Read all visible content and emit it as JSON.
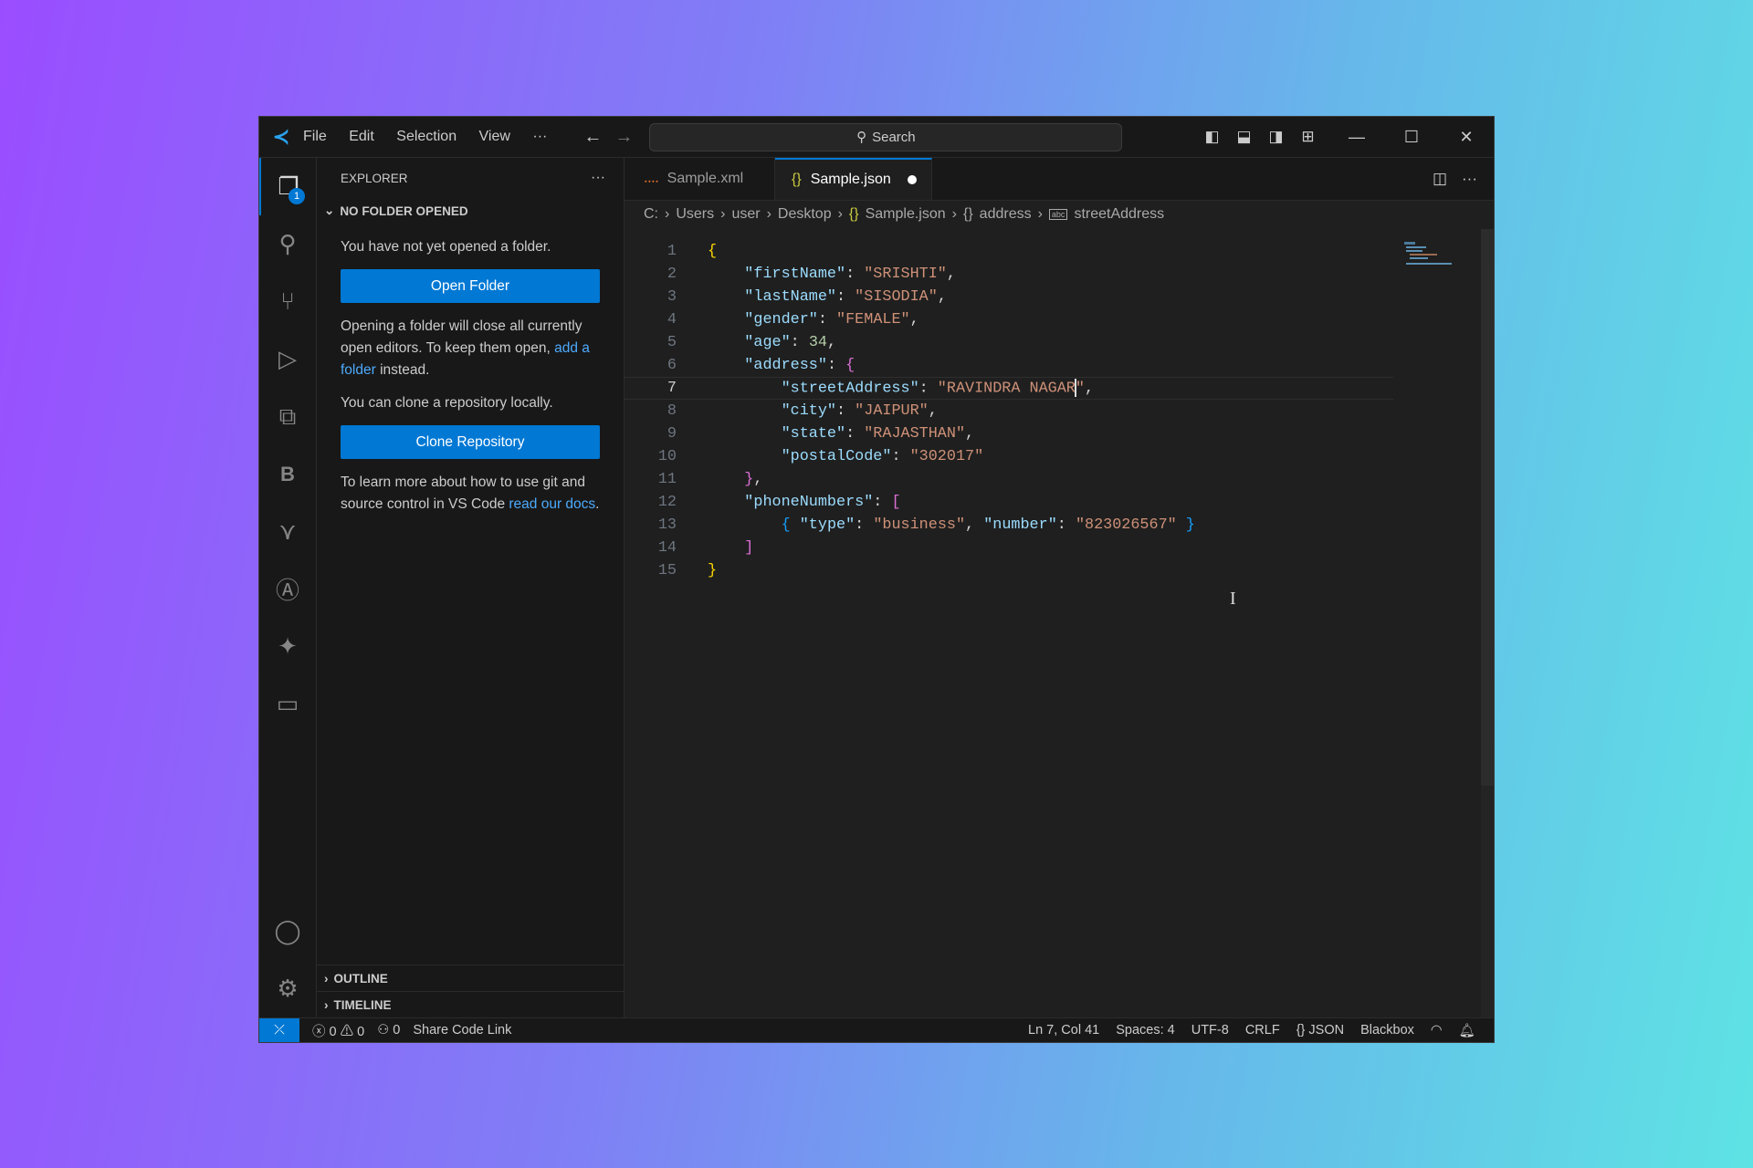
{
  "menu": {
    "items": [
      "File",
      "Edit",
      "Selection",
      "View",
      "···"
    ],
    "search": "Search"
  },
  "activity": {
    "explorer_badge": "1"
  },
  "sidebar": {
    "title": "EXPLORER",
    "more": "···",
    "section": "NO FOLDER OPENED",
    "msg1": "You have not yet opened a folder.",
    "open_folder": "Open Folder",
    "msg2_a": "Opening a folder will close all currently open editors. To keep them open, ",
    "msg2_link": "add a folder",
    "msg2_b": " instead.",
    "msg3": "You can clone a repository locally.",
    "clone": "Clone Repository",
    "msg4_a": "To learn more about how to use git and source control in VS Code ",
    "msg4_link": "read our docs",
    "msg4_b": ".",
    "outline": "OUTLINE",
    "timeline": "TIMELINE"
  },
  "tabs": [
    {
      "label": "Sample.xml"
    },
    {
      "label": "Sample.json",
      "modified": true
    }
  ],
  "breadcrumb": [
    "C:",
    "Users",
    "user",
    "Desktop",
    "Sample.json",
    "address",
    "streetAddress"
  ],
  "code": {
    "current_line": 7,
    "lines": [
      [
        [
          "{",
          "y"
        ]
      ],
      [
        [
          "    ",
          ""
        ],
        [
          "\"firstName\"",
          "k"
        ],
        [
          ": ",
          "p"
        ],
        [
          "\"SRISHTI\"",
          "s"
        ],
        [
          ",",
          "p"
        ]
      ],
      [
        [
          "    ",
          ""
        ],
        [
          "\"lastName\"",
          "k"
        ],
        [
          ": ",
          "p"
        ],
        [
          "\"SISODIA\"",
          "s"
        ],
        [
          ",",
          "p"
        ]
      ],
      [
        [
          "    ",
          ""
        ],
        [
          "\"gender\"",
          "k"
        ],
        [
          ": ",
          "p"
        ],
        [
          "\"FEMALE\"",
          "s"
        ],
        [
          ",",
          "p"
        ]
      ],
      [
        [
          "    ",
          ""
        ],
        [
          "\"age\"",
          "k"
        ],
        [
          ": ",
          "p"
        ],
        [
          "34",
          "n"
        ],
        [
          ",",
          "p"
        ]
      ],
      [
        [
          "    ",
          ""
        ],
        [
          "\"address\"",
          "k"
        ],
        [
          ": ",
          "p"
        ],
        [
          "{",
          "m"
        ]
      ],
      [
        [
          "        ",
          ""
        ],
        [
          "\"streetAddress\"",
          "k"
        ],
        [
          ": ",
          "p"
        ],
        [
          "\"RAVINDRA NAGAR",
          "s"
        ],
        [
          "|",
          "c"
        ],
        [
          "\"",
          "s"
        ],
        [
          ",",
          "p"
        ]
      ],
      [
        [
          "        ",
          ""
        ],
        [
          "\"city\"",
          "k"
        ],
        [
          ": ",
          "p"
        ],
        [
          "\"JAIPUR\"",
          "s"
        ],
        [
          ",",
          "p"
        ]
      ],
      [
        [
          "        ",
          ""
        ],
        [
          "\"state\"",
          "k"
        ],
        [
          ": ",
          "p"
        ],
        [
          "\"RAJASTHAN\"",
          "s"
        ],
        [
          ",",
          "p"
        ]
      ],
      [
        [
          "        ",
          ""
        ],
        [
          "\"postalCode\"",
          "k"
        ],
        [
          ": ",
          "p"
        ],
        [
          "\"302017\"",
          "s"
        ]
      ],
      [
        [
          "    ",
          ""
        ],
        [
          "}",
          "m"
        ],
        [
          ",",
          "p"
        ]
      ],
      [
        [
          "    ",
          ""
        ],
        [
          "\"phoneNumbers\"",
          "k"
        ],
        [
          ": ",
          "p"
        ],
        [
          "[",
          "m"
        ]
      ],
      [
        [
          "        ",
          ""
        ],
        [
          "{ ",
          "b"
        ],
        [
          "\"type\"",
          "k"
        ],
        [
          ": ",
          "p"
        ],
        [
          "\"business\"",
          "s"
        ],
        [
          ", ",
          "p"
        ],
        [
          "\"number\"",
          "k"
        ],
        [
          ": ",
          "p"
        ],
        [
          "\"823026567\"",
          "s"
        ],
        [
          " }",
          "b"
        ]
      ],
      [
        [
          "    ",
          ""
        ],
        [
          "]",
          "m"
        ]
      ],
      [
        [
          "}",
          "y"
        ]
      ]
    ]
  },
  "colors": {
    "k": "#9cdcfe",
    "s": "#ce9178",
    "n": "#b5cea8",
    "p": "#d4d4d4",
    "y": "#ffd700",
    "m": "#da70d6",
    "b": "#179fff",
    "accent": "#0078d4"
  },
  "status": {
    "errors": "0",
    "warnings": "0",
    "ports": "0",
    "share": "Share Code Link",
    "position": "Ln 7, Col 41",
    "spaces": "Spaces: 4",
    "encoding": "UTF-8",
    "eol": "CRLF",
    "language": "JSON",
    "extension": "Blackbox"
  }
}
